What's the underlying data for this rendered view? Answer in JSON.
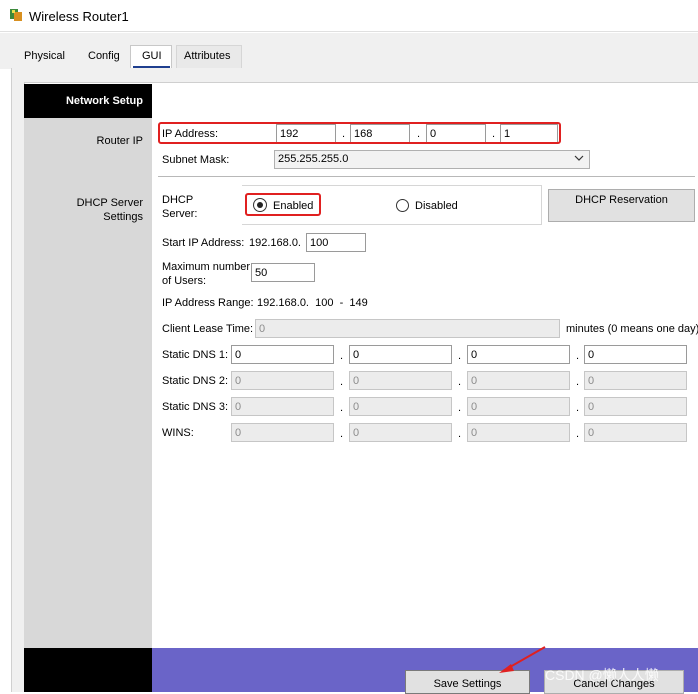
{
  "window": {
    "title": "Wireless Router1"
  },
  "tabs": [
    {
      "label": "Physical"
    },
    {
      "label": "Config"
    },
    {
      "label": "GUI"
    },
    {
      "label": "Attributes"
    }
  ],
  "header": {
    "title": "Network Setup"
  },
  "router_ip": {
    "section_label": "Router IP",
    "ip_label": "IP Address:",
    "ip": [
      "192",
      "168",
      "0",
      "1"
    ],
    "subnet_label": "Subnet Mask:",
    "subnet_value": "255.255.255.0"
  },
  "dhcp": {
    "section_label": "DHCP Server Settings",
    "server_label": "DHCP Server:",
    "enabled_label": "Enabled",
    "disabled_label": "Disabled",
    "selected": "Enabled",
    "reservation_label": "DHCP Reservation",
    "start_ip_label": "Start IP Address:",
    "start_ip_prefix": "192.168.0.",
    "start_ip_value": "100",
    "max_users_label": "Maximum number of Users:",
    "max_users_value": "50",
    "range_label": "IP Address Range:",
    "range_value": "192.168.0.  100  -  149",
    "lease_label": "Client Lease Time:",
    "lease_value": "0",
    "lease_suffix": "minutes (0 means one day)",
    "dns1_label": "Static DNS 1:",
    "dns1": [
      "0",
      "0",
      "0",
      "0"
    ],
    "dns2_label": "Static DNS 2:",
    "dns2": [
      "0",
      "0",
      "0",
      "0"
    ],
    "dns3_label": "Static DNS 3:",
    "dns3": [
      "0",
      "0",
      "0",
      "0"
    ],
    "wins_label": "WINS:",
    "wins": [
      "0",
      "0",
      "0",
      "0"
    ]
  },
  "footer": {
    "save_label": "Save Settings",
    "cancel_label": "Cancel Changes",
    "watermark": "CSDN @懒人人懒"
  },
  "colors": {
    "highlight": "#e02020",
    "footer": "#6a64c8"
  },
  "icons": {
    "app": "router-app-icon",
    "dropdown": "chevron-down-icon",
    "arrow": "red-arrow-annotation"
  }
}
